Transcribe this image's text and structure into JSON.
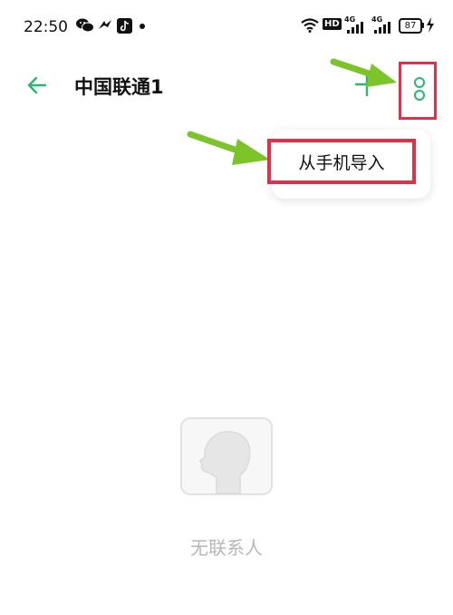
{
  "status_bar": {
    "time": "22:50",
    "hd_label": "HD",
    "signal1_label": "4G",
    "signal2_label": "4G",
    "battery": "87"
  },
  "app_bar": {
    "title": "中国联通1",
    "back_icon": "arrow-left-icon",
    "add_icon": "plus-icon",
    "more_icon": "vertical-dots-icon"
  },
  "menu": {
    "items": [
      {
        "label": "从手机导入"
      }
    ]
  },
  "empty_state": {
    "icon": "person-silhouette-icon",
    "text": "无联系人"
  },
  "colors": {
    "accent": "#2ab673",
    "highlight": "#e0304a",
    "annotation_arrow": "#7cc42a",
    "empty_text": "#b7b7b7"
  }
}
